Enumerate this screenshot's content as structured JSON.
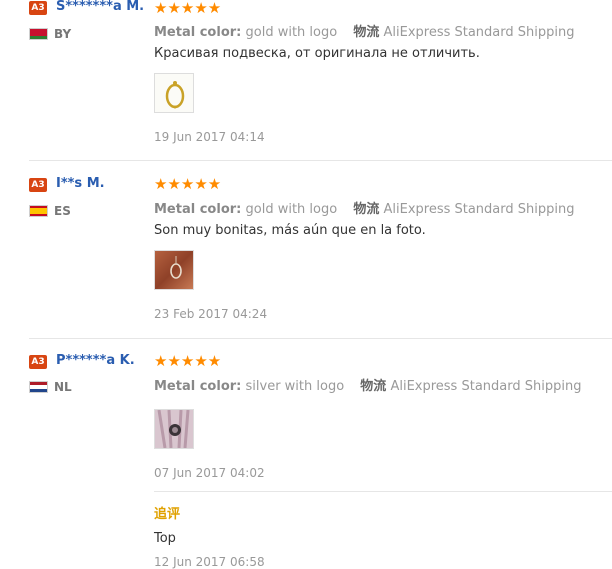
{
  "reviews": [
    {
      "badge": "A3",
      "user": "S*******a M.",
      "country": "BY",
      "stars": "★★★★★",
      "metal_label": "Metal color:",
      "metal_value": "gold with logo",
      "logistics_label": "物流",
      "shipping": "AliExpress Standard Shipping",
      "text": "Красивая подвеска, от оригинала не отличить.",
      "date": "19 Jun 2017 04:14",
      "colors": {
        "flag": [
          "#c8102e",
          "#2e7d32"
        ]
      }
    },
    {
      "badge": "A3",
      "user": "I**s M.",
      "country": "ES",
      "stars": "★★★★★",
      "metal_label": "Metal color:",
      "metal_value": "gold with logo",
      "logistics_label": "物流",
      "shipping": "AliExpress Standard Shipping",
      "text": "Son muy bonitas, más aún que en la foto.",
      "date": "23 Feb 2017 04:24",
      "colors": {
        "flag": [
          "#c60b1e",
          "#ffc400",
          "#c60b1e"
        ]
      }
    },
    {
      "badge": "A3",
      "user": "P******a K.",
      "country": "NL",
      "stars": "★★★★★",
      "metal_label": "Metal color:",
      "metal_value": "silver with logo",
      "logistics_label": "物流",
      "shipping": "AliExpress Standard Shipping",
      "text": "",
      "date": "07 Jun 2017 04:02",
      "followup": {
        "label": "追评",
        "text": "Top",
        "date": "12 Jun 2017 06:58"
      },
      "colors": {
        "flag": [
          "#ae1c28",
          "#ffffff",
          "#21468b"
        ]
      }
    }
  ],
  "colors": {
    "badge": "#d84512",
    "username": "#2a5db0",
    "stars": "#ff8b00",
    "followup_label": "#e0a100"
  }
}
